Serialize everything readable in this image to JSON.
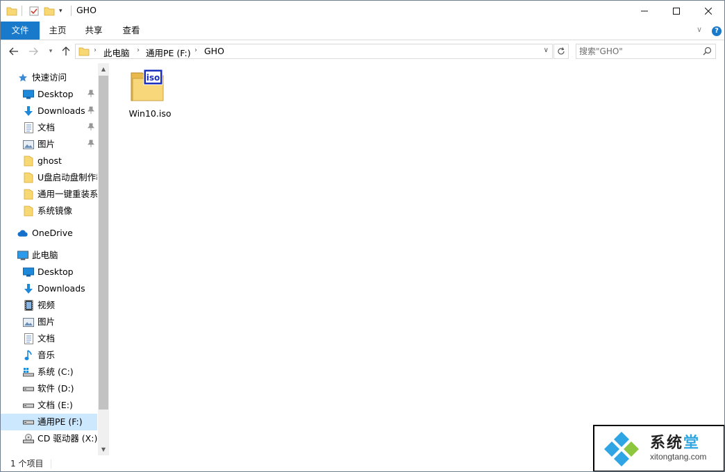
{
  "window": {
    "title": "GHO",
    "controls": {
      "minimize_icon": "minimize-icon",
      "maximize_icon": "maximize-icon",
      "close_icon": "close-icon"
    }
  },
  "ribbon": {
    "tabs": [
      {
        "label": "文件",
        "active": true
      },
      {
        "label": "主页"
      },
      {
        "label": "共享"
      },
      {
        "label": "查看"
      }
    ],
    "accent": "#1979ca"
  },
  "address": {
    "breadcrumb": [
      "此电脑",
      "通用PE (F:)",
      "GHO"
    ]
  },
  "search": {
    "placeholder": "搜索\"GHO\""
  },
  "nav": {
    "quick_access": {
      "label": "快速访问",
      "items": [
        {
          "label": "Desktop",
          "icon": "desktop-icon",
          "pinned": true
        },
        {
          "label": "Downloads",
          "icon": "downloads-icon",
          "pinned": true
        },
        {
          "label": "文档",
          "icon": "document-icon",
          "pinned": true
        },
        {
          "label": "图片",
          "icon": "picture-icon",
          "pinned": true
        },
        {
          "label": "ghost",
          "icon": "folder-icon"
        },
        {
          "label": "U盘启动盘制作教",
          "icon": "folder-icon"
        },
        {
          "label": "通用一键重装系统",
          "icon": "folder-icon"
        },
        {
          "label": "系统镜像",
          "icon": "folder-icon"
        }
      ]
    },
    "onedrive": {
      "label": "OneDrive"
    },
    "this_pc": {
      "label": "此电脑",
      "items": [
        {
          "label": "Desktop",
          "icon": "desktop-icon"
        },
        {
          "label": "Downloads",
          "icon": "downloads-icon"
        },
        {
          "label": "视频",
          "icon": "video-icon"
        },
        {
          "label": "图片",
          "icon": "picture-icon"
        },
        {
          "label": "文档",
          "icon": "document-icon"
        },
        {
          "label": "音乐",
          "icon": "music-icon"
        },
        {
          "label": "系统 (C:)",
          "icon": "system-drive-icon"
        },
        {
          "label": "软件 (D:)",
          "icon": "drive-icon"
        },
        {
          "label": "文档 (E:)",
          "icon": "drive-icon"
        },
        {
          "label": "通用PE (F:)",
          "icon": "drive-icon",
          "selected": true
        },
        {
          "label": "CD 驱动器 (X:)",
          "icon": "cd-drive-icon"
        }
      ]
    },
    "selection_color": "#cce8ff"
  },
  "content": {
    "files": [
      {
        "name": "Win10.iso",
        "icon": "iso-file-icon"
      }
    ]
  },
  "status": {
    "item_count": "1 个项目"
  },
  "watermark": {
    "title": "系统",
    "title_accent": "堂",
    "url": "xitongtang.com",
    "accent": "#30a6e0"
  }
}
